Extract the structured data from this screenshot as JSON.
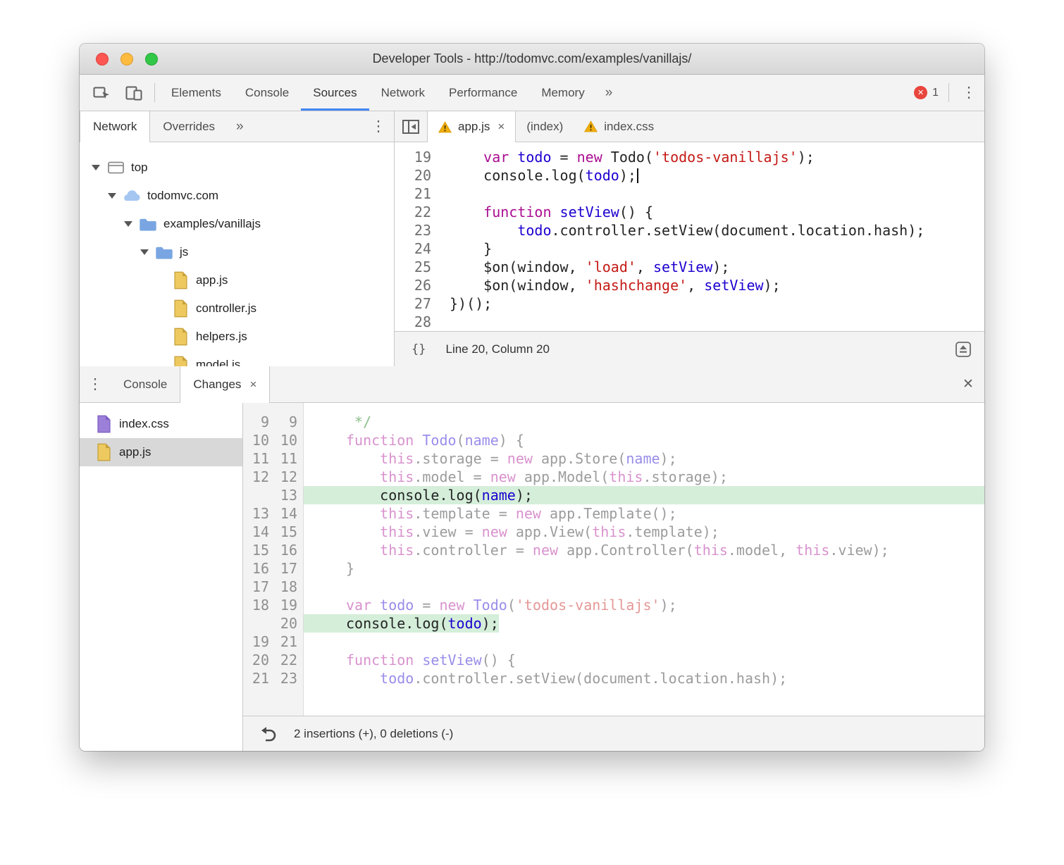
{
  "window": {
    "title": "Developer Tools - http://todomvc.com/examples/vanillajs/"
  },
  "colors": {
    "accent": "#4285f4",
    "error": "#e8453c",
    "warning": "#f0ad0c",
    "diff_added_bg": "#d4eeda",
    "keyword": "#aa0d91",
    "variable": "#1c00cf",
    "string": "#c41a16",
    "comment": "#007400"
  },
  "icons": {
    "more-chevron": "»",
    "kebab-menu": "⋮",
    "close": "✕",
    "tab-close": "×",
    "braces": "{}",
    "error-x": "✕"
  },
  "toolbar": {
    "tabs": [
      {
        "label": "Elements"
      },
      {
        "label": "Console"
      },
      {
        "label": "Sources",
        "active": true
      },
      {
        "label": "Network"
      },
      {
        "label": "Performance"
      },
      {
        "label": "Memory"
      }
    ],
    "error_count": "1"
  },
  "sidebar": {
    "tabs": [
      {
        "label": "Network",
        "active": true
      },
      {
        "label": "Overrides"
      }
    ],
    "tree": [
      {
        "label": "top",
        "icon": "frame-icon",
        "depth": 0,
        "expanded": true
      },
      {
        "label": "todomvc.com",
        "icon": "cloud-icon",
        "depth": 1,
        "expanded": true
      },
      {
        "label": "examples/vanillajs",
        "icon": "folder-icon",
        "depth": 2,
        "expanded": true
      },
      {
        "label": "js",
        "icon": "folder-icon",
        "depth": 3,
        "expanded": true
      },
      {
        "label": "app.js",
        "icon": "file-js-icon",
        "depth": 4
      },
      {
        "label": "controller.js",
        "icon": "file-js-icon",
        "depth": 4
      },
      {
        "label": "helpers.js",
        "icon": "file-js-icon",
        "depth": 4
      },
      {
        "label": "model.js",
        "icon": "file-js-icon",
        "depth": 4
      }
    ]
  },
  "editor": {
    "tabs": [
      {
        "label": "app.js",
        "warning": true,
        "closable": true,
        "active": true
      },
      {
        "label": "(index)"
      },
      {
        "label": "index.css",
        "warning": true
      }
    ],
    "status": {
      "line_col": "Line 20, Column 20"
    },
    "lines": [
      {
        "num": "19",
        "segs": [
          {
            "t": "    ",
            "c": "d"
          },
          {
            "t": "var",
            "c": "k"
          },
          {
            "t": " ",
            "c": "d"
          },
          {
            "t": "todo",
            "c": "v"
          },
          {
            "t": " = ",
            "c": "d"
          },
          {
            "t": "new",
            "c": "k"
          },
          {
            "t": " Todo(",
            "c": "d"
          },
          {
            "t": "'todos-vanillajs'",
            "c": "s"
          },
          {
            "t": ");",
            "c": "d"
          }
        ]
      },
      {
        "num": "20",
        "caret": true,
        "segs": [
          {
            "t": "    console.log(",
            "c": "d"
          },
          {
            "t": "todo",
            "c": "v"
          },
          {
            "t": ");",
            "c": "d"
          }
        ]
      },
      {
        "num": "21",
        "segs": []
      },
      {
        "num": "22",
        "segs": [
          {
            "t": "    ",
            "c": "d"
          },
          {
            "t": "function",
            "c": "k"
          },
          {
            "t": " ",
            "c": "d"
          },
          {
            "t": "setView",
            "c": "v"
          },
          {
            "t": "() {",
            "c": "d"
          }
        ]
      },
      {
        "num": "23",
        "segs": [
          {
            "t": "        ",
            "c": "d"
          },
          {
            "t": "todo",
            "c": "v"
          },
          {
            "t": ".controller.setView(document.location.hash);",
            "c": "d"
          }
        ]
      },
      {
        "num": "24",
        "segs": [
          {
            "t": "    }",
            "c": "d"
          }
        ]
      },
      {
        "num": "25",
        "segs": [
          {
            "t": "    $on(window, ",
            "c": "d"
          },
          {
            "t": "'load'",
            "c": "s"
          },
          {
            "t": ", ",
            "c": "d"
          },
          {
            "t": "setView",
            "c": "v"
          },
          {
            "t": ");",
            "c": "d"
          }
        ]
      },
      {
        "num": "26",
        "segs": [
          {
            "t": "    $on(window, ",
            "c": "d"
          },
          {
            "t": "'hashchange'",
            "c": "s"
          },
          {
            "t": ", ",
            "c": "d"
          },
          {
            "t": "setView",
            "c": "v"
          },
          {
            "t": ");",
            "c": "d"
          }
        ]
      },
      {
        "num": "27",
        "segs": [
          {
            "t": "})();",
            "c": "d"
          }
        ]
      },
      {
        "num": "28",
        "segs": []
      }
    ]
  },
  "drawer": {
    "tabs": [
      {
        "label": "Console"
      },
      {
        "label": "Changes",
        "active": true,
        "closable": true
      }
    ],
    "files": [
      {
        "label": "index.css",
        "icon": "file-css-icon"
      },
      {
        "label": "app.js",
        "icon": "file-js-icon",
        "selected": true
      }
    ],
    "diff": {
      "footer": "2 insertions (+), 0 deletions (-)",
      "rows": [
        {
          "old": "9",
          "new": "9",
          "segs": [
            {
              "t": " ",
              "c": "d"
            },
            {
              "t": "*/",
              "c": "c"
            }
          ]
        },
        {
          "old": "10",
          "new": "10",
          "segs": [
            {
              "t": "function",
              "c": "k"
            },
            {
              "t": " ",
              "c": "d"
            },
            {
              "t": "Todo",
              "c": "v"
            },
            {
              "t": "(",
              "c": "d"
            },
            {
              "t": "name",
              "c": "v"
            },
            {
              "t": ") {",
              "c": "d"
            }
          ]
        },
        {
          "old": "11",
          "new": "11",
          "segs": [
            {
              "t": "    ",
              "c": "d"
            },
            {
              "t": "this",
              "c": "k"
            },
            {
              "t": ".storage = ",
              "c": "d"
            },
            {
              "t": "new",
              "c": "k"
            },
            {
              "t": " app.Store(",
              "c": "d"
            },
            {
              "t": "name",
              "c": "v"
            },
            {
              "t": ");",
              "c": "d"
            }
          ]
        },
        {
          "old": "12",
          "new": "12",
          "segs": [
            {
              "t": "    ",
              "c": "d"
            },
            {
              "t": "this",
              "c": "k"
            },
            {
              "t": ".model = ",
              "c": "d"
            },
            {
              "t": "new",
              "c": "k"
            },
            {
              "t": " app.Model(",
              "c": "d"
            },
            {
              "t": "this",
              "c": "k"
            },
            {
              "t": ".storage);",
              "c": "d"
            }
          ]
        },
        {
          "old": "",
          "new": "13",
          "added": "full",
          "segs": [
            {
              "t": "    console.log(",
              "c": "d"
            },
            {
              "t": "name",
              "c": "v"
            },
            {
              "t": ");",
              "c": "d"
            }
          ]
        },
        {
          "old": "13",
          "new": "14",
          "segs": [
            {
              "t": "    ",
              "c": "d"
            },
            {
              "t": "this",
              "c": "k"
            },
            {
              "t": ".template = ",
              "c": "d"
            },
            {
              "t": "new",
              "c": "k"
            },
            {
              "t": " app.Template();",
              "c": "d"
            }
          ]
        },
        {
          "old": "14",
          "new": "15",
          "segs": [
            {
              "t": "    ",
              "c": "d"
            },
            {
              "t": "this",
              "c": "k"
            },
            {
              "t": ".view = ",
              "c": "d"
            },
            {
              "t": "new",
              "c": "k"
            },
            {
              "t": " app.View(",
              "c": "d"
            },
            {
              "t": "this",
              "c": "k"
            },
            {
              "t": ".template);",
              "c": "d"
            }
          ]
        },
        {
          "old": "15",
          "new": "16",
          "segs": [
            {
              "t": "    ",
              "c": "d"
            },
            {
              "t": "this",
              "c": "k"
            },
            {
              "t": ".controller = ",
              "c": "d"
            },
            {
              "t": "new",
              "c": "k"
            },
            {
              "t": " app.Controller(",
              "c": "d"
            },
            {
              "t": "this",
              "c": "k"
            },
            {
              "t": ".model, ",
              "c": "d"
            },
            {
              "t": "this",
              "c": "k"
            },
            {
              "t": ".view);",
              "c": "d"
            }
          ]
        },
        {
          "old": "16",
          "new": "17",
          "segs": [
            {
              "t": "}",
              "c": "d"
            }
          ]
        },
        {
          "old": "17",
          "new": "18",
          "segs": []
        },
        {
          "old": "18",
          "new": "19",
          "segs": [
            {
              "t": "var",
              "c": "k"
            },
            {
              "t": " ",
              "c": "d"
            },
            {
              "t": "todo",
              "c": "v"
            },
            {
              "t": " = ",
              "c": "d"
            },
            {
              "t": "new",
              "c": "k"
            },
            {
              "t": " ",
              "c": "d"
            },
            {
              "t": "Todo",
              "c": "v"
            },
            {
              "t": "(",
              "c": "d"
            },
            {
              "t": "'todos-vanillajs'",
              "c": "s"
            },
            {
              "t": ");",
              "c": "d"
            }
          ]
        },
        {
          "old": "",
          "new": "20",
          "added": "inline",
          "segs": [
            {
              "t": "console.log(",
              "c": "d"
            },
            {
              "t": "todo",
              "c": "v"
            },
            {
              "t": ");",
              "c": "d"
            }
          ]
        },
        {
          "old": "19",
          "new": "21",
          "segs": []
        },
        {
          "old": "20",
          "new": "22",
          "segs": [
            {
              "t": "function",
              "c": "k"
            },
            {
              "t": " ",
              "c": "d"
            },
            {
              "t": "setView",
              "c": "v"
            },
            {
              "t": "() {",
              "c": "d"
            }
          ]
        },
        {
          "old": "21",
          "new": "23",
          "segs": [
            {
              "t": "    ",
              "c": "d"
            },
            {
              "t": "todo",
              "c": "v"
            },
            {
              "t": ".controller.setView(document.location.hash);",
              "c": "d"
            }
          ]
        }
      ]
    }
  }
}
